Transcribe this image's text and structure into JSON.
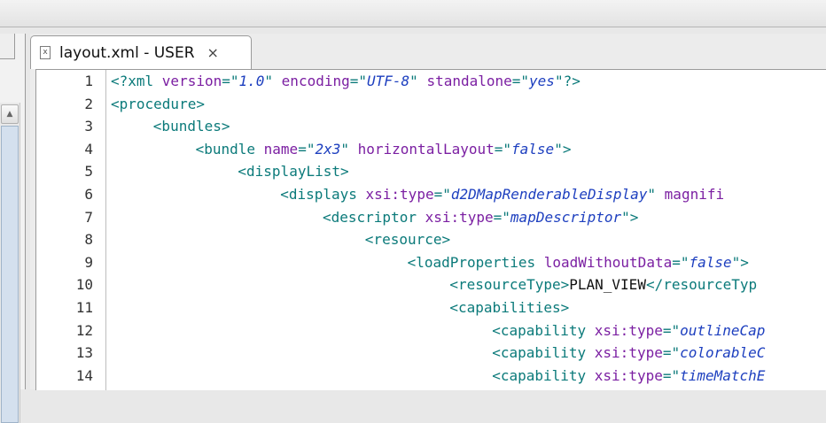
{
  "tab": {
    "title": "layout.xml - USER",
    "close_label": "×",
    "icon": "xml-file-icon",
    "icon_glyph": "x"
  },
  "left_panel": {
    "scroll_up_glyph": "▲"
  },
  "colors": {
    "tag": "#0b7a7a",
    "attribute": "#7b1fa2",
    "value": "#1d3fbf",
    "text": "#111111"
  },
  "editor": {
    "lines": [
      {
        "n": "1",
        "indent": 0,
        "tokens": [
          {
            "t": "tag",
            "v": "<?xml "
          },
          {
            "t": "attr",
            "v": "version"
          },
          {
            "t": "tag",
            "v": "=\""
          },
          {
            "t": "val",
            "v": "1.0"
          },
          {
            "t": "tag",
            "v": "\" "
          },
          {
            "t": "attr",
            "v": "encoding"
          },
          {
            "t": "tag",
            "v": "=\""
          },
          {
            "t": "val",
            "v": "UTF-8"
          },
          {
            "t": "tag",
            "v": "\" "
          },
          {
            "t": "attr",
            "v": "standalone"
          },
          {
            "t": "tag",
            "v": "=\""
          },
          {
            "t": "val",
            "v": "yes"
          },
          {
            "t": "tag",
            "v": "\"?>"
          }
        ]
      },
      {
        "n": "2",
        "indent": 0,
        "tokens": [
          {
            "t": "tag",
            "v": "<procedure>"
          }
        ]
      },
      {
        "n": "3",
        "indent": 1,
        "tokens": [
          {
            "t": "tag",
            "v": "<bundles>"
          }
        ]
      },
      {
        "n": "4",
        "indent": 2,
        "tokens": [
          {
            "t": "tag",
            "v": "<bundle "
          },
          {
            "t": "attr",
            "v": "name"
          },
          {
            "t": "tag",
            "v": "=\""
          },
          {
            "t": "val",
            "v": "2x3"
          },
          {
            "t": "tag",
            "v": "\" "
          },
          {
            "t": "attr",
            "v": "horizontalLayout"
          },
          {
            "t": "tag",
            "v": "=\""
          },
          {
            "t": "val",
            "v": "false"
          },
          {
            "t": "tag",
            "v": "\">"
          }
        ]
      },
      {
        "n": "5",
        "indent": 3,
        "tokens": [
          {
            "t": "tag",
            "v": "<displayList>"
          }
        ]
      },
      {
        "n": "6",
        "indent": 4,
        "tokens": [
          {
            "t": "tag",
            "v": "<displays "
          },
          {
            "t": "attr",
            "v": "xsi:type"
          },
          {
            "t": "tag",
            "v": "=\""
          },
          {
            "t": "val",
            "v": "d2DMapRenderableDisplay"
          },
          {
            "t": "tag",
            "v": "\" "
          },
          {
            "t": "attr",
            "v": "magnifi"
          }
        ]
      },
      {
        "n": "7",
        "indent": 5,
        "tokens": [
          {
            "t": "tag",
            "v": "<descriptor "
          },
          {
            "t": "attr",
            "v": "xsi:type"
          },
          {
            "t": "tag",
            "v": "=\""
          },
          {
            "t": "val",
            "v": "mapDescriptor"
          },
          {
            "t": "tag",
            "v": "\">"
          }
        ]
      },
      {
        "n": "8",
        "indent": 6,
        "tokens": [
          {
            "t": "tag",
            "v": "<resource>"
          }
        ]
      },
      {
        "n": "9",
        "indent": 7,
        "tokens": [
          {
            "t": "tag",
            "v": "<loadProperties "
          },
          {
            "t": "attr",
            "v": "loadWithoutData"
          },
          {
            "t": "tag",
            "v": "=\""
          },
          {
            "t": "val",
            "v": "false"
          },
          {
            "t": "tag",
            "v": "\">"
          }
        ]
      },
      {
        "n": "10",
        "indent": 8,
        "tokens": [
          {
            "t": "tag",
            "v": "<resourceType>"
          },
          {
            "t": "text",
            "v": "PLAN_VIEW"
          },
          {
            "t": "tag",
            "v": "</resourceTyp"
          }
        ]
      },
      {
        "n": "11",
        "indent": 8,
        "tokens": [
          {
            "t": "tag",
            "v": "<capabilities>"
          }
        ]
      },
      {
        "n": "12",
        "indent": 9,
        "tokens": [
          {
            "t": "tag",
            "v": "<capability "
          },
          {
            "t": "attr",
            "v": "xsi:type"
          },
          {
            "t": "tag",
            "v": "=\""
          },
          {
            "t": "val",
            "v": "outlineCap"
          }
        ]
      },
      {
        "n": "13",
        "indent": 9,
        "tokens": [
          {
            "t": "tag",
            "v": "<capability "
          },
          {
            "t": "attr",
            "v": "xsi:type"
          },
          {
            "t": "tag",
            "v": "=\""
          },
          {
            "t": "val",
            "v": "colorableC"
          }
        ]
      },
      {
        "n": "14",
        "indent": 9,
        "tokens": [
          {
            "t": "tag",
            "v": "<capability "
          },
          {
            "t": "attr",
            "v": "xsi:type"
          },
          {
            "t": "tag",
            "v": "=\""
          },
          {
            "t": "val",
            "v": "timeMatchE"
          }
        ]
      }
    ]
  }
}
